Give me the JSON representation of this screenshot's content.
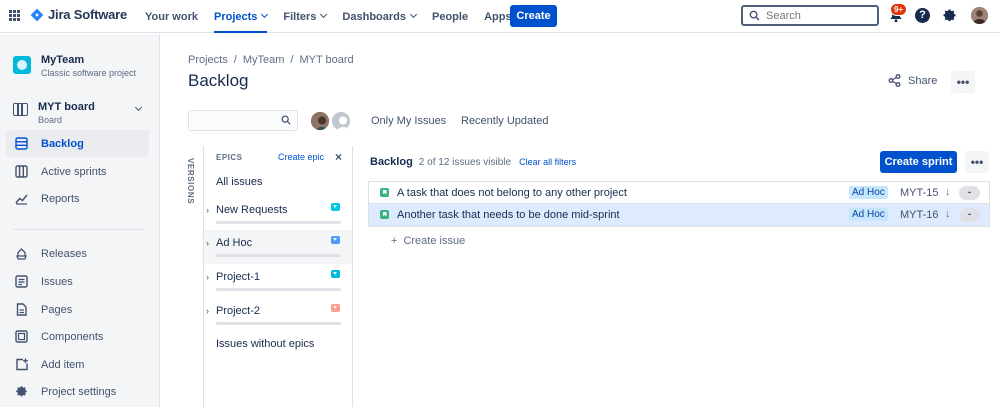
{
  "topnav": {
    "product_name": "Jira Software",
    "items": [
      {
        "label": "Your work",
        "active": false,
        "has_dropdown": false
      },
      {
        "label": "Projects",
        "active": true,
        "has_dropdown": true
      },
      {
        "label": "Filters",
        "active": false,
        "has_dropdown": true
      },
      {
        "label": "Dashboards",
        "active": false,
        "has_dropdown": true
      },
      {
        "label": "People",
        "active": false,
        "has_dropdown": false
      },
      {
        "label": "Apps",
        "active": false,
        "has_dropdown": true
      }
    ],
    "create_label": "Create",
    "search_placeholder": "Search",
    "notification_badge": "9+",
    "help_glyph": "?",
    "icons": [
      "app-switcher-icon",
      "jira-logo-icon",
      "search-icon",
      "notifications-icon",
      "help-icon",
      "settings-icon",
      "profile-avatar"
    ]
  },
  "sidebar": {
    "project_name": "MyTeam",
    "project_type": "Classic software project",
    "board_name": "MYT board",
    "board_sub": "Board",
    "items": [
      {
        "label": "Backlog",
        "icon": "backlog-icon",
        "active": true
      },
      {
        "label": "Active sprints",
        "icon": "board-icon",
        "active": false
      },
      {
        "label": "Reports",
        "icon": "reports-icon",
        "active": false
      },
      {
        "label": "Releases",
        "icon": "releases-icon",
        "active": false
      },
      {
        "label": "Issues",
        "icon": "issues-icon",
        "active": false
      },
      {
        "label": "Pages",
        "icon": "pages-icon",
        "active": false
      },
      {
        "label": "Components",
        "icon": "components-icon",
        "active": false
      },
      {
        "label": "Add item",
        "icon": "add-item-icon",
        "active": false
      },
      {
        "label": "Project settings",
        "icon": "settings-icon",
        "active": false
      }
    ]
  },
  "main": {
    "breadcrumb": [
      "Projects",
      "MyTeam",
      "MYT board"
    ],
    "breadcrumb_sep": "/",
    "title": "Backlog",
    "share_label": "Share",
    "more_glyph": "•••",
    "filters": [
      "Only My Issues",
      "Recently Updated"
    ]
  },
  "epics": {
    "versions_label": "VERSIONS",
    "header": "EPICS",
    "create_label": "Create epic",
    "close_glyph": "×",
    "all_issues": "All issues",
    "items": [
      {
        "name": "New Requests",
        "color": "#00c7e6"
      },
      {
        "name": "Ad Hoc",
        "color": "#4c9aff"
      },
      {
        "name": "Project-1",
        "color": "#00b8d9"
      },
      {
        "name": "Project-2",
        "color": "#f99d8f"
      }
    ],
    "without_epics": "Issues without epics"
  },
  "backlog": {
    "title": "Backlog",
    "count_text": "2 of 12 issues visible",
    "clear_filters": "Clear all filters",
    "create_sprint": "Create sprint",
    "issues": [
      {
        "summary": "A task that does not belong to any other project",
        "epic": "Ad Hoc",
        "key": "MYT-15",
        "priority_glyph": "↓",
        "estimate": "-",
        "selected": false
      },
      {
        "summary": "Another task that needs to be done mid-sprint",
        "epic": "Ad Hoc",
        "key": "MYT-16",
        "priority_glyph": "↓",
        "estimate": "-",
        "selected": true
      }
    ],
    "create_issue_plus": "+",
    "create_issue": "Create issue"
  },
  "colors": {
    "brand": "#0052cc",
    "sidebar_bg": "#f4f5f7",
    "story_green": "#36b37e",
    "selected_row": "#deebff",
    "epic_label_bg": "#c5e6fb",
    "badge_red": "#de350b"
  }
}
